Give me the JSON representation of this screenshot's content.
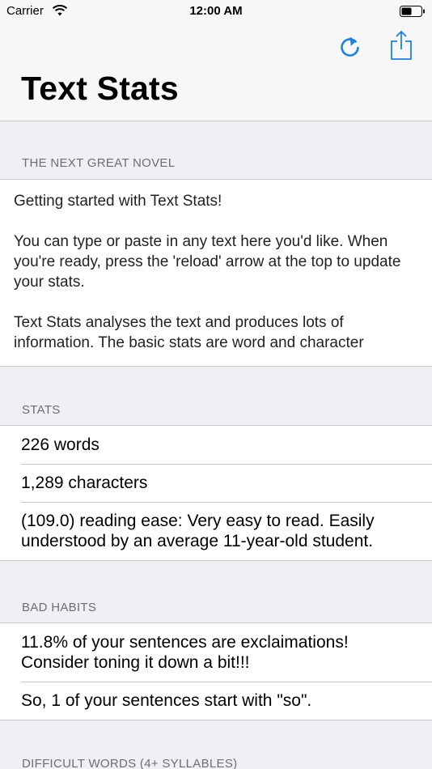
{
  "status_bar": {
    "carrier": "Carrier",
    "time": "12:00 AM"
  },
  "nav": {
    "title": "Text Stats",
    "reload_icon": "reload-arrow-icon",
    "share_icon": "share-icon",
    "accent_color": "#1a82e8"
  },
  "document": {
    "header": "THE NEXT GREAT NOVEL",
    "text": "Getting started with Text Stats!\n\nYou can type or paste in any text here you'd like. When you're ready, press the 'reload' arrow at the top to update your stats.\n\nText Stats analyses the text and produces lots of information. The basic stats are word and character"
  },
  "stats": {
    "header": "STATS",
    "rows": [
      "226 words",
      "1,289 characters",
      "(109.0) reading ease: Very easy to read. Easily understood by an average 11-year-old student."
    ]
  },
  "bad_habits": {
    "header": "BAD HABITS",
    "rows": [
      "11.8% of your sentences are exclaimations! Consider toning it down a bit!!!",
      "So, 1 of your sentences start with \"so\"."
    ]
  },
  "difficult_words": {
    "header": "DIFFICULT WORDS (4+ SYLLABLES)"
  }
}
